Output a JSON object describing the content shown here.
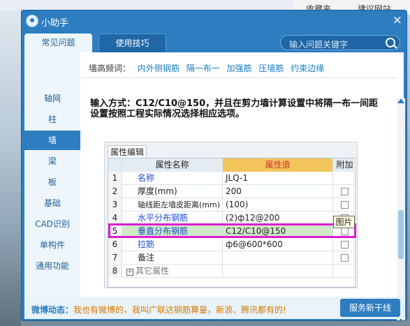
{
  "desktop": {
    "tabs": [
      "收藏夹",
      "建议网站"
    ]
  },
  "window": {
    "title": "小助手",
    "close_label": "×"
  },
  "tabs": {
    "faq": "常见问题",
    "tips": "使用技巧"
  },
  "search": {
    "placeholder": "输入问题关键字"
  },
  "sidebar": {
    "items": [
      "轴网",
      "柱",
      "墙",
      "梁",
      "板",
      "基础",
      "CAD识别",
      "单构件",
      "通用功能"
    ],
    "active_index": 2
  },
  "content": {
    "keywords_label": "墙高频词：",
    "keywords": [
      "内外侧钢筋",
      "隔一布一",
      "加强筋",
      "压墙筋",
      "约束边缘"
    ],
    "instruction": "输入方式：C12/C10@150，并且在剪力墙计算设置中将隔一布一间距设置按照工程实际情况选择相应选项。"
  },
  "property_panel": {
    "tab_label": "属性编辑",
    "headers": [
      "",
      "属性名称",
      "属性值",
      "附加"
    ],
    "rows": [
      {
        "no": "1",
        "name": "名称",
        "value": "JLQ-1",
        "blue": true,
        "checkbox": false
      },
      {
        "no": "2",
        "name": "厚度(mm)",
        "value": "200",
        "blue": false,
        "checkbox": true
      },
      {
        "no": "3",
        "name": "轴线距左墙皮距离(mm)",
        "value": "(100)",
        "blue": false,
        "checkbox": true
      },
      {
        "no": "4",
        "name": "水平分布钢筋",
        "value": "(2)ф12@200",
        "blue": true,
        "checkbox": true
      },
      {
        "no": "5",
        "name": "垂直分布钢筋",
        "value": "C12/C10@150",
        "blue": true,
        "checkbox": true
      },
      {
        "no": "6",
        "name": "拉筋",
        "value": "ф6@600*600",
        "blue": true,
        "checkbox": true
      },
      {
        "no": "7",
        "name": "备注",
        "value": "",
        "blue": false,
        "checkbox": true
      },
      {
        "no": "8",
        "name": "其它属性",
        "value": "",
        "blue": false,
        "checkbox": false
      }
    ],
    "tooltip": "图片",
    "ellipsis": "…"
  },
  "footer": {
    "label": "微博动态：",
    "message": "我也有微博的，我叫广联达钢筋算量，新浪、腾讯都有的!",
    "button": "服务新干线"
  },
  "colors": {
    "window_blue": "#2d7dc0",
    "highlight_magenta": "#e01bd0",
    "header_orange": "#f3c45a"
  }
}
